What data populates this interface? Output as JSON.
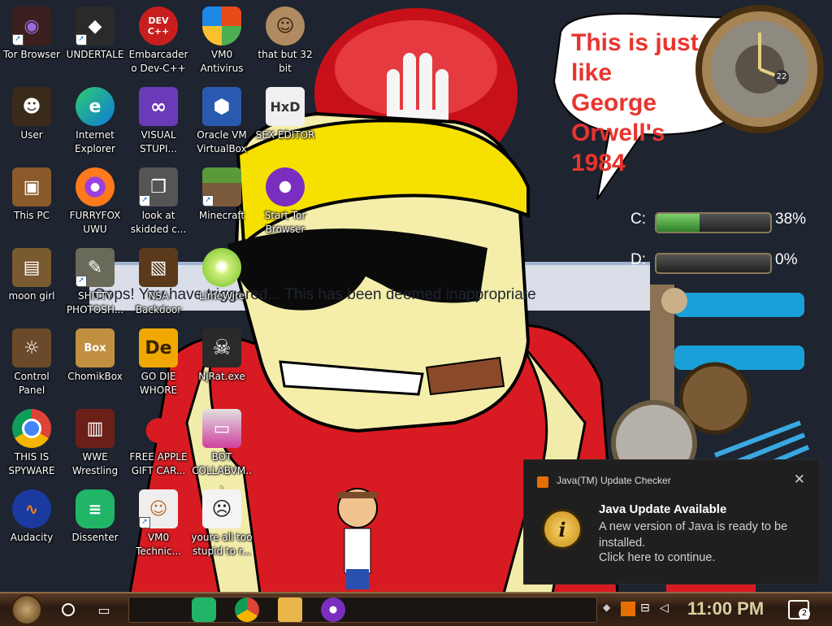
{
  "wallpaper": {
    "speech_bubble": "This is just like\nGeorge Orwell's\n1984",
    "webpage_text": "Oops! You have triggered... This has been deemed inappropriate"
  },
  "desktop_icons": [
    {
      "label": "Tor Browser",
      "icon": "tor-browser-icon"
    },
    {
      "label": "UNDERTALE",
      "icon": "undertale-icon"
    },
    {
      "label": "Embarcadero Dev-C++",
      "icon": "devcpp-icon",
      "text": "DEV C++"
    },
    {
      "label": "VM0 Antivirus",
      "icon": "shield-icon"
    },
    {
      "label": "that but 32 bit",
      "icon": "portrait-icon"
    },
    {
      "label": "User",
      "icon": "user-folder-icon"
    },
    {
      "label": "Internet Explorer",
      "icon": "edge-icon"
    },
    {
      "label": "VISUAL STUPI...",
      "icon": "visual-studio-icon"
    },
    {
      "label": "Oracle VM VirtualBox",
      "icon": "virtualbox-icon"
    },
    {
      "label": "SEX EDITOR",
      "icon": "hex-editor-icon",
      "text": "HxD"
    },
    {
      "label": "This PC",
      "icon": "computer-icon"
    },
    {
      "label": "FURRYFOX UWU",
      "icon": "firefox-icon"
    },
    {
      "label": "look at skidded c...",
      "icon": "copy-icon"
    },
    {
      "label": "Minecraft",
      "icon": "minecraft-icon"
    },
    {
      "label": "Start Tor Browser",
      "icon": "tor-onion-icon"
    },
    {
      "label": "moon girl",
      "icon": "folder-icon"
    },
    {
      "label": "SHITTY PHOTOSH...",
      "icon": "gimp-icon"
    },
    {
      "label": "NSA Backdoor",
      "icon": "nsa-folder-icon"
    },
    {
      "label": "LimeWire",
      "icon": "limewire-icon"
    },
    {
      "label": "Control Panel",
      "icon": "control-panel-icon"
    },
    {
      "label": "ChomikBox",
      "icon": "chomikbox-icon",
      "text": "Box"
    },
    {
      "label": "GO DIE WHORE",
      "icon": "adobe-de-icon",
      "text": "De"
    },
    {
      "label": "NjRat.exe",
      "icon": "skull-icon"
    },
    {
      "label": "THIS IS SPYWARE",
      "icon": "chrome-icon"
    },
    {
      "label": "WWE Wrestling",
      "icon": "wwe-icon"
    },
    {
      "label": "FREE APPLE GIFT CAR...",
      "icon": "apple-icon"
    },
    {
      "label": "BOT COLLABVM...",
      "icon": "bot-monitor-icon"
    },
    {
      "label": "Audacity",
      "icon": "audacity-icon"
    },
    {
      "label": "Dissenter",
      "icon": "dissenter-icon"
    },
    {
      "label": "VM0 Technic...",
      "icon": "technician-icon"
    },
    {
      "label": "youre all too stupid to r...",
      "icon": "meme-face-icon"
    }
  ],
  "gauges": {
    "drives": [
      {
        "letter": "C:",
        "percent_label": "38%",
        "percent": 38
      },
      {
        "letter": "D:",
        "percent_label": "0%",
        "percent": 0
      }
    ],
    "clock_day": "22"
  },
  "notification": {
    "app_name": "Java(TM) Update Checker",
    "title": "Java Update Available",
    "body": "A new version of Java is ready to be installed.",
    "action": "Click here to continue.",
    "close_glyph": "✕",
    "info_glyph": "i"
  },
  "taskbar": {
    "time": "11:00 PM",
    "notification_count": "2",
    "pinned": [
      "dissenter-icon",
      "chrome-icon",
      "file-explorer-icon",
      "tor-onion-icon"
    ]
  }
}
